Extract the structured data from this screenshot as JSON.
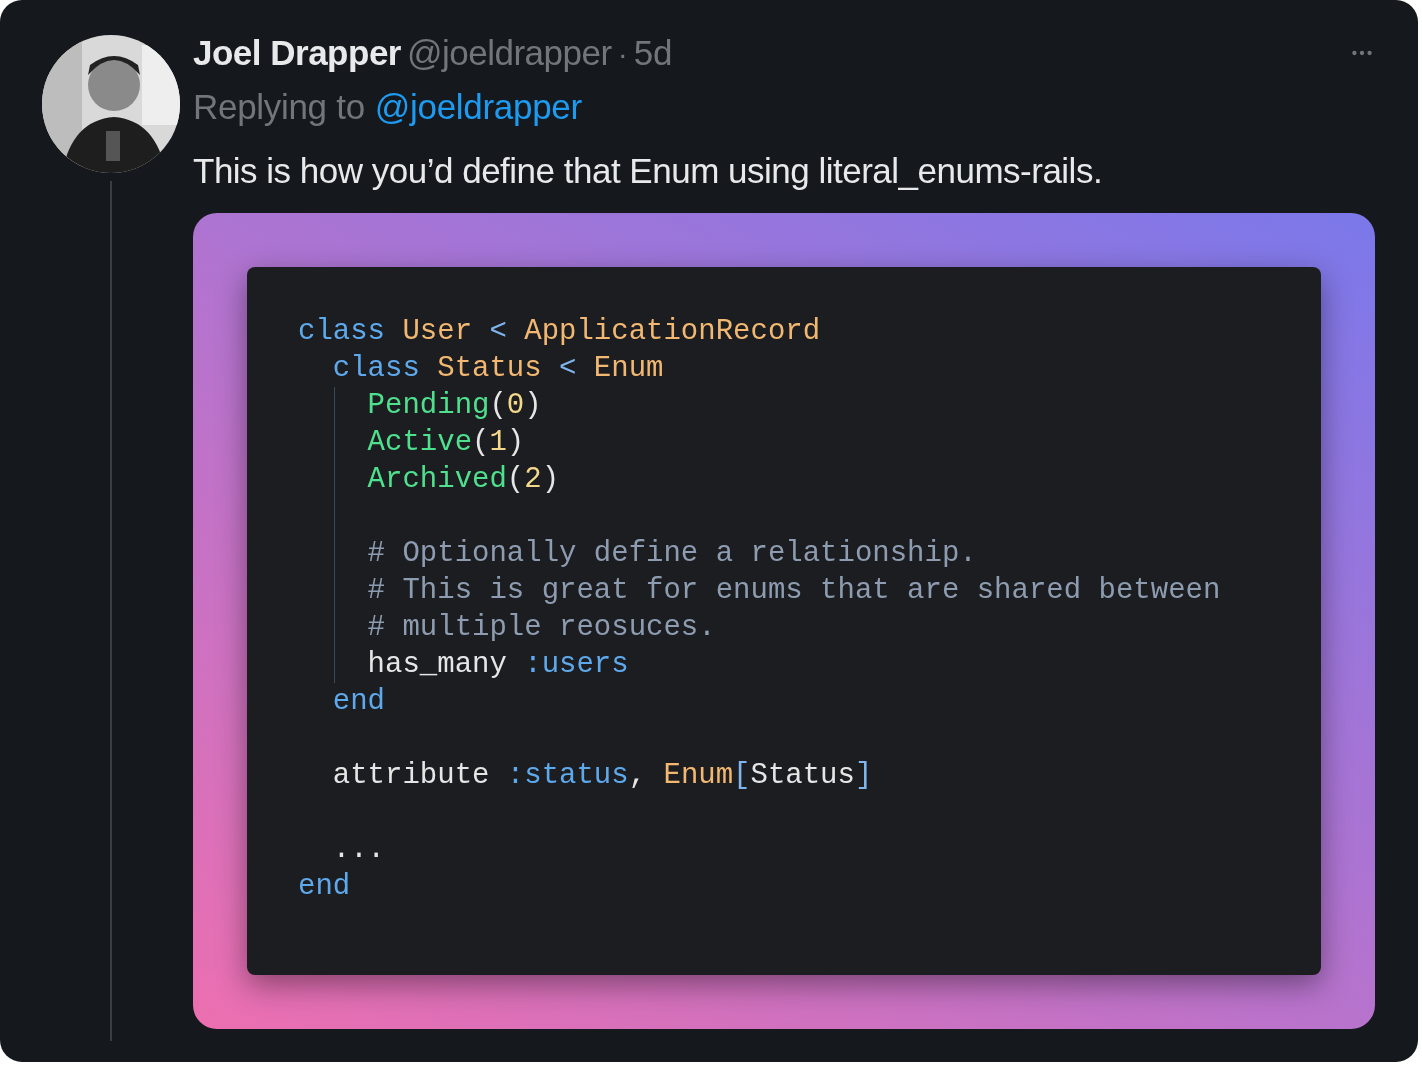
{
  "tweet": {
    "author": "Joel Drapper",
    "handle": "@joeldrapper",
    "separator": "·",
    "time": "5d",
    "reply_prefix": "Replying to",
    "reply_to": "@joeldrapper",
    "text": "This is how you’d define that Enum using literal_enums-rails."
  },
  "code": [
    {
      "kind": "code",
      "guide": false,
      "tokens": [
        {
          "kind": "keyword",
          "text": "class"
        },
        {
          "kind": "constant",
          "text": " User"
        },
        {
          "kind": "operator",
          "text": " <"
        },
        {
          "kind": "constant",
          "text": " ApplicationRecord"
        }
      ]
    },
    {
      "kind": "code",
      "guide": false,
      "tokens": [
        {
          "kind": "keyword",
          "text": "  class"
        },
        {
          "kind": "constant",
          "text": " Status"
        },
        {
          "kind": "operator",
          "text": " <"
        },
        {
          "kind": "constant",
          "text": " Enum"
        }
      ]
    },
    {
      "kind": "code",
      "guide": true,
      "tokens": [
        {
          "kind": "variant",
          "text": "    Pending"
        },
        {
          "kind": "plain",
          "text": "("
        },
        {
          "kind": "number",
          "text": "0"
        },
        {
          "kind": "plain",
          "text": ")"
        }
      ]
    },
    {
      "kind": "code",
      "guide": true,
      "tokens": [
        {
          "kind": "variant",
          "text": "    Active"
        },
        {
          "kind": "plain",
          "text": "("
        },
        {
          "kind": "number",
          "text": "1"
        },
        {
          "kind": "plain",
          "text": ")"
        }
      ]
    },
    {
      "kind": "code",
      "guide": true,
      "tokens": [
        {
          "kind": "variant",
          "text": "    Archived"
        },
        {
          "kind": "plain",
          "text": "("
        },
        {
          "kind": "number",
          "text": "2"
        },
        {
          "kind": "plain",
          "text": ")"
        }
      ]
    },
    {
      "kind": "blank",
      "guide": true
    },
    {
      "kind": "code",
      "guide": true,
      "tokens": [
        {
          "kind": "comment",
          "text": "    # Optionally define a relationship."
        }
      ]
    },
    {
      "kind": "code",
      "guide": true,
      "tokens": [
        {
          "kind": "comment",
          "text": "    # This is great for enums that are shared between"
        }
      ]
    },
    {
      "kind": "code",
      "guide": true,
      "tokens": [
        {
          "kind": "comment",
          "text": "    # multiple reosuces."
        }
      ]
    },
    {
      "kind": "code",
      "guide": true,
      "tokens": [
        {
          "kind": "plain",
          "text": "    has_many"
        },
        {
          "kind": "symbol",
          "text": " :users"
        }
      ]
    },
    {
      "kind": "code",
      "guide": false,
      "tokens": [
        {
          "kind": "keyword",
          "text": "  end"
        }
      ]
    },
    {
      "kind": "blank",
      "guide": false
    },
    {
      "kind": "code",
      "guide": false,
      "tokens": [
        {
          "kind": "plain",
          "text": "  attribute"
        },
        {
          "kind": "symbol",
          "text": " :status"
        },
        {
          "kind": "plain",
          "text": ","
        },
        {
          "kind": "constant",
          "text": " Enum"
        },
        {
          "kind": "operator",
          "text": "["
        },
        {
          "kind": "plain",
          "text": "Status"
        },
        {
          "kind": "operator",
          "text": "]"
        }
      ]
    },
    {
      "kind": "blank",
      "guide": false
    },
    {
      "kind": "code",
      "guide": false,
      "tokens": [
        {
          "kind": "plain",
          "text": "  ..."
        }
      ]
    },
    {
      "kind": "code",
      "guide": false,
      "tokens": [
        {
          "kind": "keyword",
          "text": "end"
        }
      ]
    }
  ]
}
